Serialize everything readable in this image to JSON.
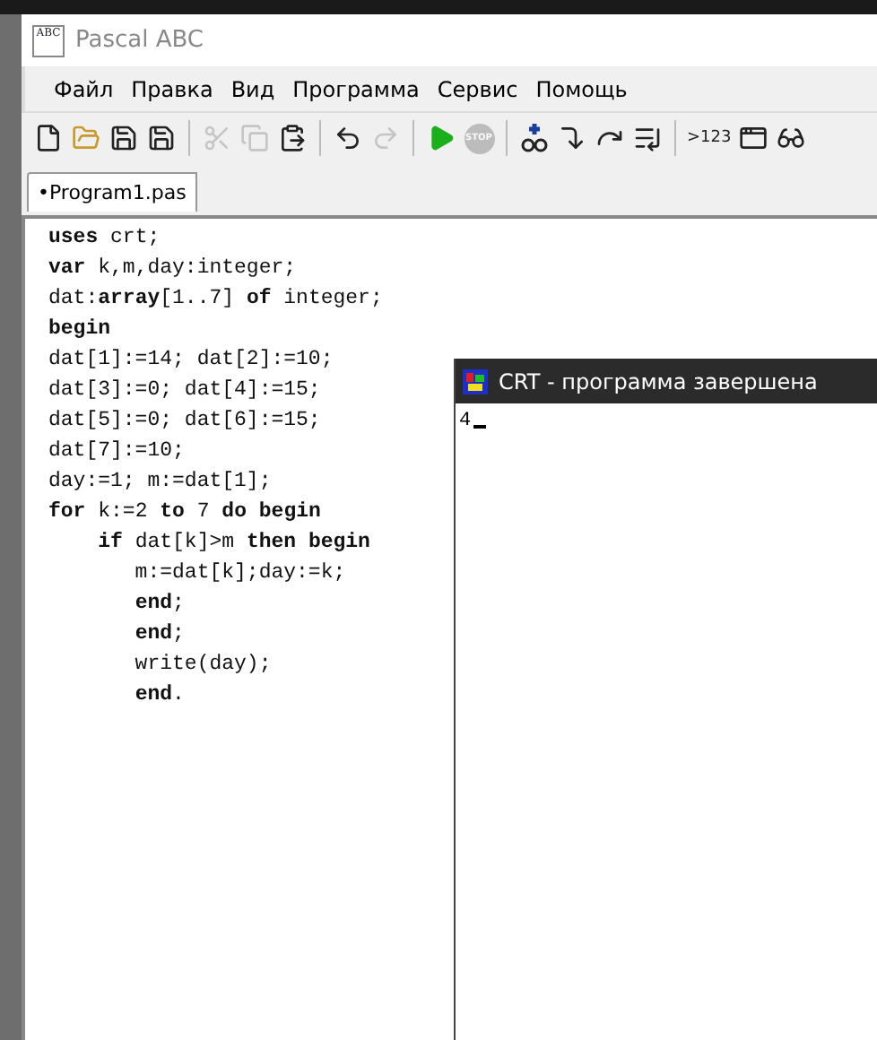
{
  "window": {
    "title": "Pascal ABC",
    "logo": "ABC"
  },
  "menu": [
    "Файл",
    "Правка",
    "Вид",
    "Программа",
    "Сервис",
    "Помощь"
  ],
  "toolbar": [
    {
      "kind": "new",
      "disabled": false
    },
    {
      "kind": "open",
      "disabled": false
    },
    {
      "kind": "save",
      "disabled": false
    },
    {
      "kind": "saveall",
      "disabled": false
    },
    {
      "kind": "separator"
    },
    {
      "kind": "cut",
      "disabled": true
    },
    {
      "kind": "copy",
      "disabled": true
    },
    {
      "kind": "paste",
      "disabled": false
    },
    {
      "kind": "separator"
    },
    {
      "kind": "undo",
      "disabled": false
    },
    {
      "kind": "redo",
      "disabled": true
    },
    {
      "kind": "separator"
    },
    {
      "kind": "run",
      "disabled": false
    },
    {
      "kind": "stop",
      "disabled": true,
      "label": "STOP"
    },
    {
      "kind": "separator"
    },
    {
      "kind": "watch",
      "disabled": false
    },
    {
      "kind": "stepinto",
      "disabled": false
    },
    {
      "kind": "stepover",
      "disabled": false
    },
    {
      "kind": "runto",
      "disabled": false
    },
    {
      "kind": "separator"
    },
    {
      "kind": "eval",
      "disabled": false,
      "label": ">123"
    },
    {
      "kind": "window",
      "disabled": false
    },
    {
      "kind": "glasses",
      "disabled": false
    }
  ],
  "tabs": [
    {
      "label": "•Program1.pas",
      "selected": true
    }
  ],
  "editor": {
    "lines": [
      "**uses** crt;",
      "**var** k,m,day:integer;",
      "dat:**array**[1..7] **of** integer;",
      "**begin**",
      "dat[1]:=14; dat[2]:=10;",
      "dat[3]:=0; dat[4]:=15;",
      "dat[5]:=0; dat[6]:=15;",
      "dat[7]:=10;",
      "day:=1; m:=dat[1];",
      "**for** k:=2 **to** 7 **do** **begin**",
      "    **if** dat[k]>m **then** **begin**",
      "       m:=dat[k];day:=k;",
      "       **end**;",
      "       **end**;",
      "       write(day);",
      "       **end**."
    ]
  },
  "output_window": {
    "title": "CRT - программа завершена",
    "output": "4"
  }
}
